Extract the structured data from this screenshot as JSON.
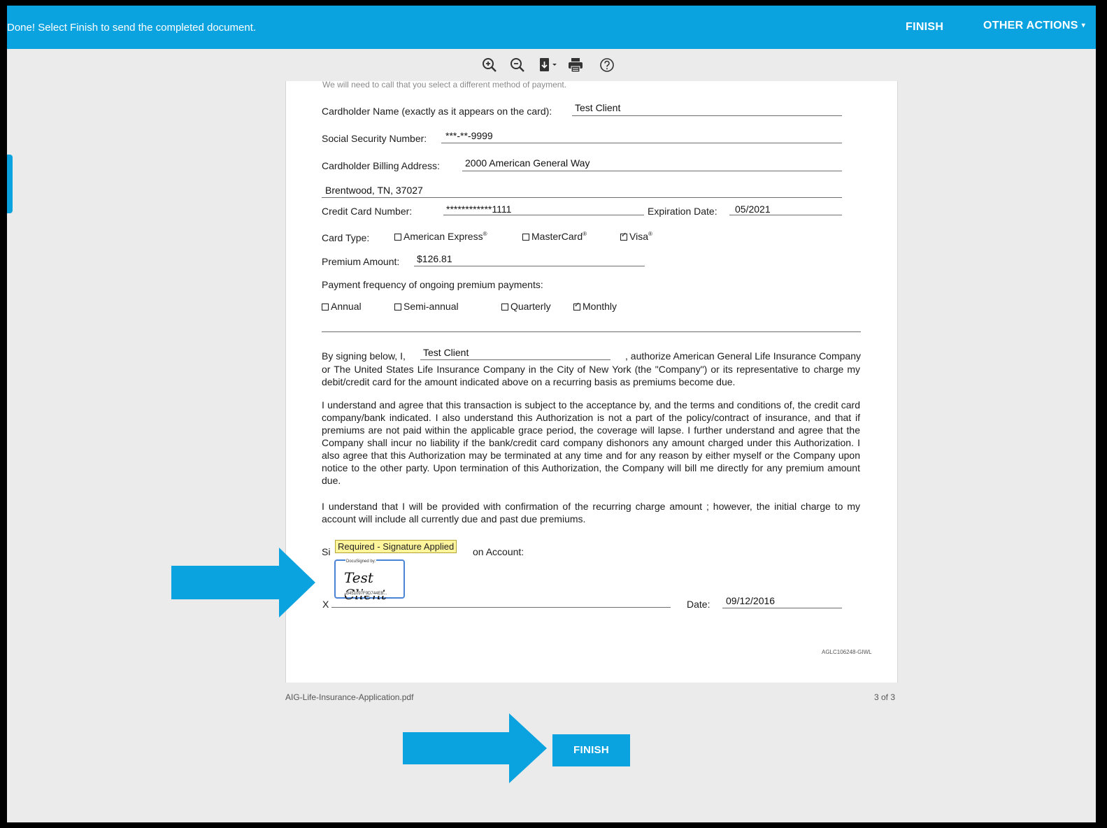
{
  "topbar": {
    "message": "Done! Select Finish to send the completed document.",
    "finish_label": "FINISH",
    "other_actions_label": "OTHER ACTIONS",
    "other_actions_caret": "▾"
  },
  "toolbar": {
    "buttons": [
      "zoom-in-icon",
      "zoom-out-icon",
      "download-icon",
      "print-icon",
      "help-icon"
    ]
  },
  "document": {
    "clipped_top_text": "We will need to call that you select a different method of payment.",
    "cardholder_name_label": "Cardholder Name (exactly as it appears on the card):",
    "cardholder_name_value": "Test Client",
    "ssn_label": "Social Security Number:",
    "ssn_value": "***-**-9999",
    "billing_address_label": "Cardholder Billing Address:",
    "billing_address_line1": "2000 American General Way",
    "billing_address_line2": "Brentwood, TN, 37027",
    "card_number_label": "Credit Card Number:",
    "card_number_value": "************1111",
    "expiration_label": "Expiration Date:",
    "expiration_value": "05/2021",
    "card_type_label": "Card Type:",
    "card_types": [
      {
        "label": "American Express",
        "checked": false
      },
      {
        "label": "MasterCard",
        "checked": false
      },
      {
        "label": "Visa",
        "checked": true
      }
    ],
    "registered_mark": "®",
    "premium_label": "Premium Amount:",
    "premium_value": "$126.81",
    "frequency_label": "Payment frequency of ongoing premium payments:",
    "frequencies": [
      {
        "label": "Annual",
        "checked": false
      },
      {
        "label": "Semi-annual",
        "checked": false
      },
      {
        "label": "Quarterly",
        "checked": false
      },
      {
        "label": "Monthly",
        "checked": true
      }
    ],
    "auth_prefix": "By signing below, I,",
    "auth_name": "Test  Client",
    "auth_line1_suffix": ", authorize American General Life Insurance Company",
    "auth_rest": "or The United States Life Insurance Company in the City of New York (the \"Company\") or its representative to charge my debit/credit card for the amount indicated above on a recurring basis as premiums become due.",
    "para2": "I understand and agree that this transaction is subject to the acceptance by, and the terms and conditions of, the credit card company/bank indicated. I also understand this Authorization is not a part of the policy/contract of insurance, and that if premiums are not paid within the applicable grace period, the coverage will lapse. I further understand and agree that the Company shall incur no liability if the bank/credit card company dishonors any amount charged under this Authorization. I also agree that this Authorization may be terminated at any time and for any reason by either myself or the Company upon notice to the other party. Upon termination of this Authorization, the Company will bill me directly for any premium amount due.",
    "para3": "I understand that I will be provided with confirmation of the recurring charge amount ; however, the initial charge to my account will include all currently due and past due premiums.",
    "signature_label_start": "Si",
    "signature_label_end": "on Account:",
    "signature_tooltip": "Required - Signature Applied",
    "docusigned_by": "DocuSigned by:",
    "signature_handwriting": "Test Client",
    "signature_id": "B451097F9D744EB...",
    "sign_x": "X",
    "date_label": "Date:",
    "date_value": "09/12/2016",
    "form_id": "AGLC106248-GIWL"
  },
  "footer": {
    "filename": "AIG-Life-Insurance-Application.pdf",
    "page_count": "3 of 3",
    "finish_label": "FINISH"
  },
  "colors": {
    "accent": "#0ba3df",
    "canvas": "#ebebeb",
    "tooltip": "#fff59d",
    "signature_border": "#4a84d6"
  }
}
